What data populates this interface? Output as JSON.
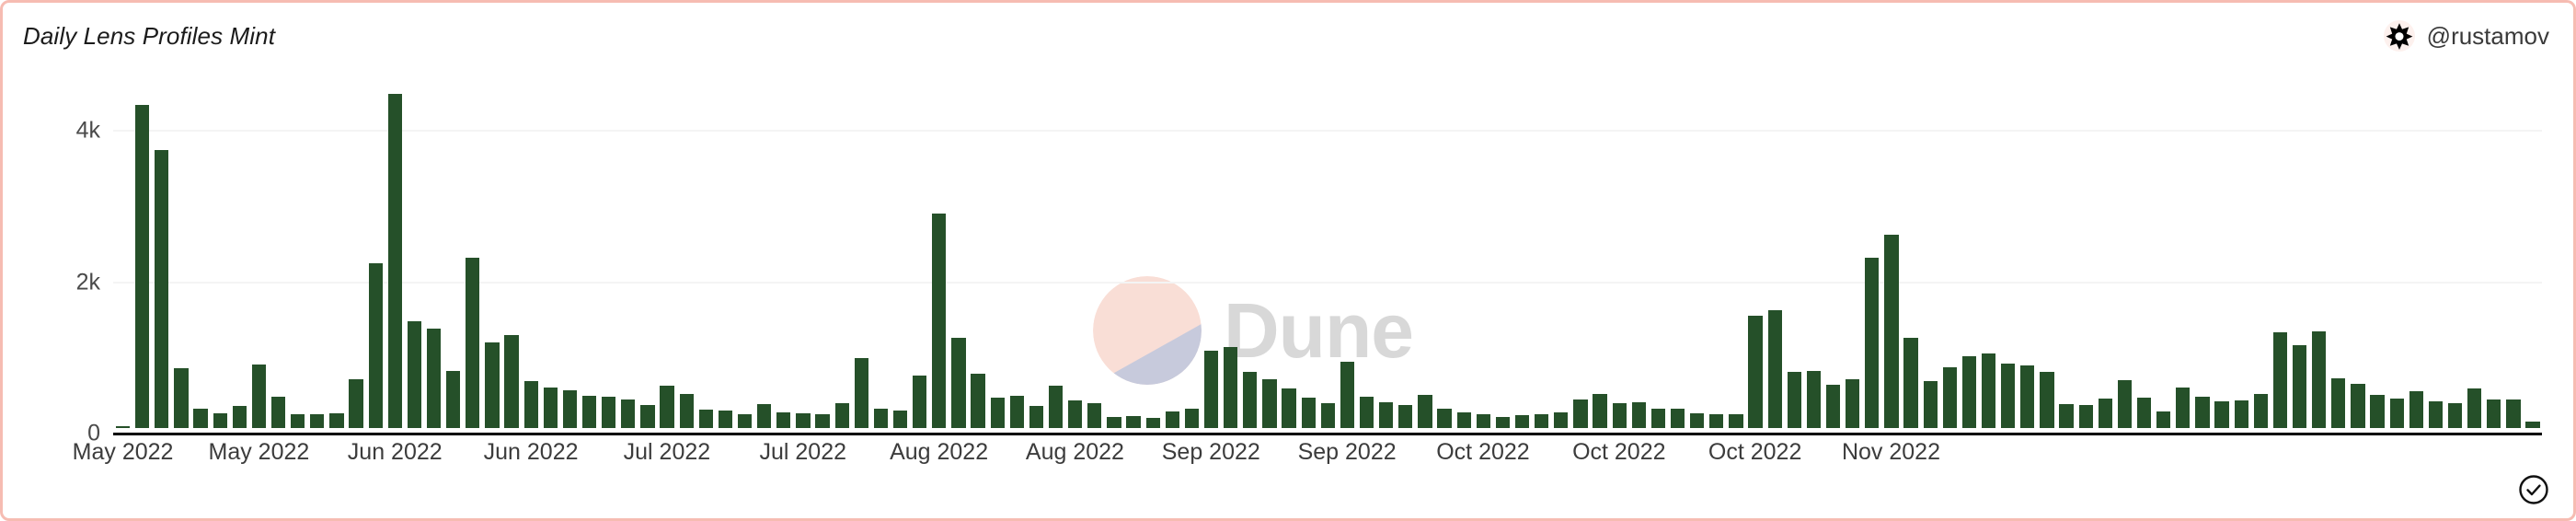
{
  "header": {
    "title": "Daily Lens Profiles Mint",
    "author_handle": "@rustamov",
    "avatar_icon": "dune-star-icon"
  },
  "footer": {
    "status_icon": "check-circle-icon"
  },
  "watermark": {
    "text": "Dune",
    "mark_icon": "dune-logo-icon",
    "top_color": "#f9ded6",
    "bottom_color": "#c7cadc",
    "text_color": "#d8d8d8"
  },
  "theme": {
    "bar_color": "#255029",
    "border_color": "#f6bcb2",
    "gridline_color": "#f4f4f4",
    "axis_color": "#000000",
    "label_color": "#3c3c3c",
    "background": "#ffffff"
  },
  "chart_data": {
    "type": "bar",
    "title": "Daily Lens Profiles Mint",
    "xlabel": "",
    "ylabel": "",
    "ylim": [
      0,
      4600
    ],
    "grid": true,
    "legend": false,
    "ytick_labels": [
      "0",
      "2k",
      "4k"
    ],
    "ytick_values": [
      0,
      2000,
      4000
    ],
    "xtick_labels": [
      "May 2022",
      "May 2022",
      "Jun 2022",
      "Jun 2022",
      "Jul 2022",
      "Jul 2022",
      "Aug 2022",
      "Aug 2022",
      "Sep 2022",
      "Sep 2022",
      "Oct 2022",
      "Oct 2022",
      "Oct 2022",
      "Nov 2022"
    ],
    "xtick_positions": [
      0,
      7,
      14,
      21,
      28,
      35,
      42,
      49,
      56,
      63,
      70,
      77,
      84,
      91
    ],
    "series_name": "Lens Profiles Minted",
    "values": [
      20,
      4270,
      3670,
      790,
      250,
      200,
      290,
      840,
      420,
      180,
      180,
      200,
      640,
      2180,
      4420,
      1410,
      1320,
      760,
      2250,
      1130,
      1230,
      620,
      540,
      500,
      430,
      420,
      380,
      300,
      560,
      450,
      240,
      230,
      180,
      320,
      210,
      200,
      180,
      330,
      930,
      260,
      230,
      690,
      2830,
      1190,
      720,
      400,
      430,
      290,
      560,
      370,
      330,
      150,
      160,
      130,
      220,
      250,
      1020,
      1070,
      740,
      640,
      520,
      400,
      330,
      880,
      420,
      340,
      300,
      440,
      260,
      210,
      180,
      150,
      170,
      180,
      210,
      380,
      450,
      330,
      340,
      250,
      260,
      200,
      180,
      180,
      1480,
      1560,
      740,
      760,
      570,
      640,
      2250,
      2560,
      1190,
      620,
      800,
      950,
      990,
      850,
      830,
      740,
      320,
      310,
      390,
      630,
      400,
      220,
      530,
      420,
      350,
      370,
      450,
      1270,
      1100,
      1280,
      660,
      580,
      440,
      390,
      490,
      350,
      330,
      520,
      380,
      380,
      80
    ]
  }
}
